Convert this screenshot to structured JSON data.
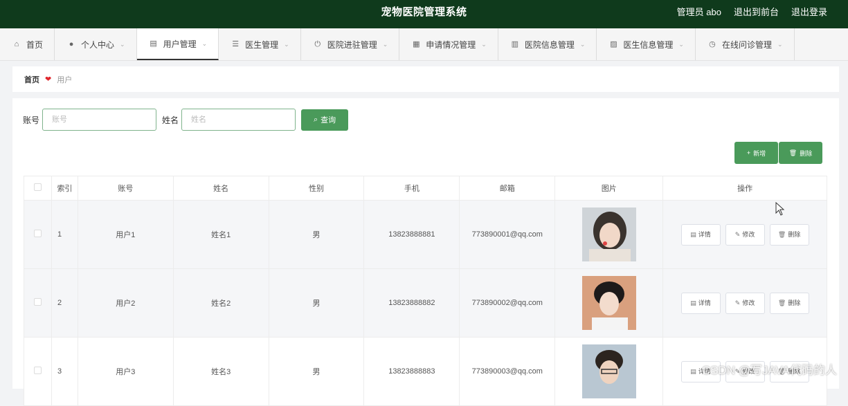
{
  "header": {
    "title": "宠物医院管理系统",
    "admin": "管理员 abo",
    "front": "退出到前台",
    "logout": "退出登录"
  },
  "nav": [
    {
      "label": "首页",
      "icon": "home-icon"
    },
    {
      "label": "个人中心",
      "icon": "user-icon"
    },
    {
      "label": "用户管理",
      "icon": "clipboard-icon"
    },
    {
      "label": "医生管理",
      "icon": "list-icon"
    },
    {
      "label": "医院进驻管理",
      "icon": "power-icon"
    },
    {
      "label": "申请情况管理",
      "icon": "grid-icon"
    },
    {
      "label": "医院信息管理",
      "icon": "table-icon"
    },
    {
      "label": "医生信息管理",
      "icon": "chart-icon"
    },
    {
      "label": "在线问诊管理",
      "icon": "clock-icon"
    }
  ],
  "breadcrumb": {
    "home": "首页",
    "current": "用户"
  },
  "search": {
    "account_label": "账号",
    "account_placeholder": "账号",
    "name_label": "姓名",
    "name_placeholder": "姓名",
    "query": "查询"
  },
  "actions": {
    "add": "新增",
    "delete": "删除"
  },
  "table": {
    "headers": [
      "索引",
      "账号",
      "姓名",
      "性别",
      "手机",
      "邮箱",
      "图片",
      "操作"
    ],
    "rows": [
      {
        "index": "1",
        "account": "用户1",
        "name": "姓名1",
        "gender": "男",
        "phone": "13823888881",
        "email": "773890001@qq.com"
      },
      {
        "index": "2",
        "account": "用户2",
        "name": "姓名2",
        "gender": "男",
        "phone": "13823888882",
        "email": "773890002@qq.com"
      },
      {
        "index": "3",
        "account": "用户3",
        "name": "姓名3",
        "gender": "男",
        "phone": "13823888883",
        "email": "773890003@qq.com"
      }
    ],
    "op_detail": "详情",
    "op_edit": "修改",
    "op_delete": "删除"
  },
  "watermark": "CSDN @写JAVA代码的人"
}
